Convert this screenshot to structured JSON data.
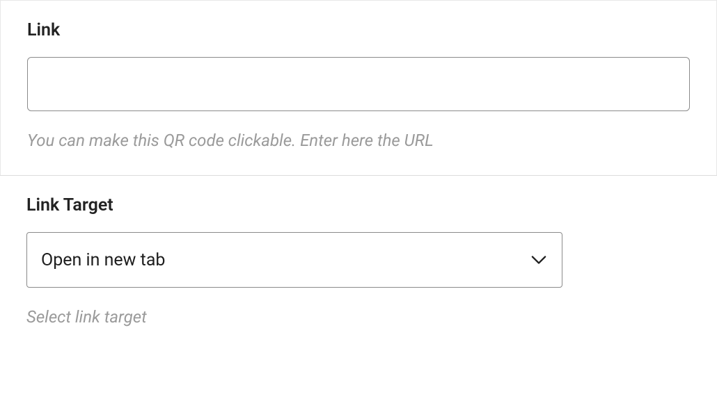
{
  "link_section": {
    "label": "Link",
    "value": "",
    "helper": "You can make this QR code clickable. Enter here the URL"
  },
  "link_target_section": {
    "label": "Link Target",
    "selected": "Open in new tab",
    "helper": "Select link target"
  }
}
